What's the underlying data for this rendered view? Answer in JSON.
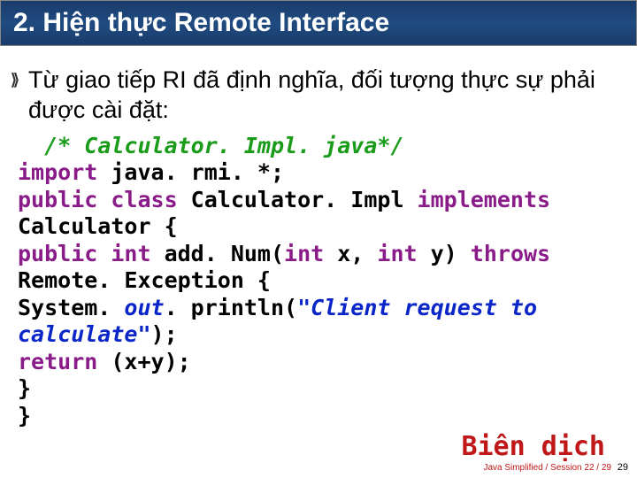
{
  "title": "2. Hiện thực Remote Interface",
  "bullet": "Từ giao tiếp RI đã định nghĩa, đối tượng thực sự phải được cài đặt:",
  "code": {
    "c1": "/* Calculator. Impl. java*/",
    "c2a": "import",
    "c2b": " java. rmi. *;",
    "c3a": "public class ",
    "c3b": "Calculator. Impl ",
    "c3c": "implements",
    "c4": "Calculator {",
    "c5a": "public int ",
    "c5b": "add. Num(",
    "c5c": "int",
    "c5d": " x, ",
    "c5e": "int",
    "c5f": " y) ",
    "c5g": "throws",
    "c6": "Remote. Exception {",
    "c7a": "System. ",
    "c7b": "out",
    "c7c": ". println(",
    "c7d": "\"Client request to calculate\"",
    "c7e": ");",
    "c8a": "return",
    "c8b": " (x+y);",
    "c9": "        }",
    "c10": "}"
  },
  "compile": "Biên dịch",
  "footer_text": "Java Simplified / Session 22 / 29",
  "page_num": "29"
}
